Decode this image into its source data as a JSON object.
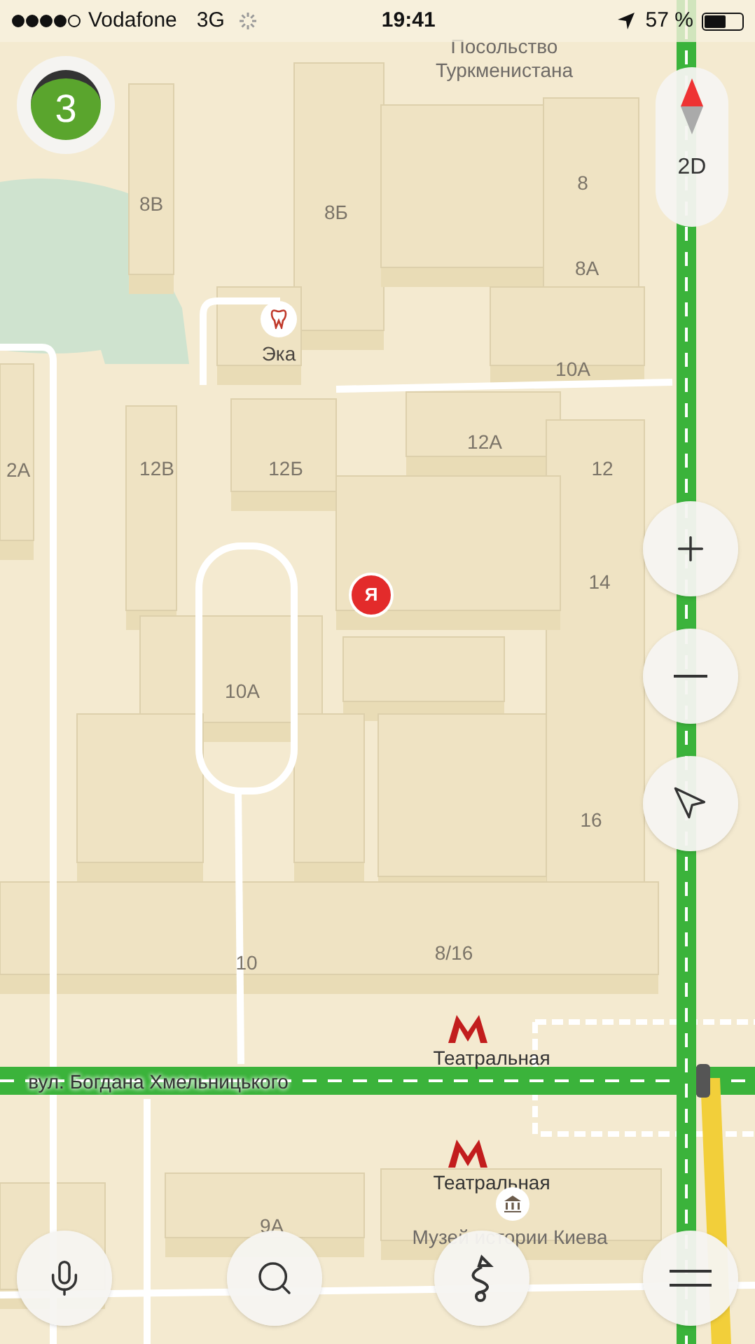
{
  "status_bar": {
    "carrier": "Vodafone",
    "network": "3G",
    "time": "19:41",
    "battery": "57 %"
  },
  "traffic_badge": {
    "score": "3"
  },
  "view_toggle": {
    "label": "2D"
  },
  "map_labels": [
    {
      "kind": "poi",
      "text": "Посольство Туркменистана"
    },
    {
      "kind": "number",
      "text": "8В"
    },
    {
      "kind": "number",
      "text": "8Б"
    },
    {
      "kind": "number",
      "text": "8"
    },
    {
      "kind": "number",
      "text": "8А"
    },
    {
      "kind": "dentist",
      "text": "Эка"
    },
    {
      "kind": "number",
      "text": "10А"
    },
    {
      "kind": "number",
      "text": "2А"
    },
    {
      "kind": "number",
      "text": "12В"
    },
    {
      "kind": "number",
      "text": "12Б"
    },
    {
      "kind": "number",
      "text": "12А"
    },
    {
      "kind": "number",
      "text": "12"
    },
    {
      "kind": "me",
      "text": "Я"
    },
    {
      "kind": "number",
      "text": "14"
    },
    {
      "kind": "number",
      "text": "10А"
    },
    {
      "kind": "number",
      "text": "16"
    },
    {
      "kind": "number",
      "text": "10"
    },
    {
      "kind": "number",
      "text": "8/16"
    },
    {
      "kind": "metro",
      "text": "Театральная"
    },
    {
      "kind": "street",
      "text": "вул. Богдана Хмельницького"
    },
    {
      "kind": "metro",
      "text": "Театральная"
    },
    {
      "kind": "number",
      "text": "9А"
    },
    {
      "kind": "museum",
      "text": "Музей истории Киева"
    }
  ]
}
